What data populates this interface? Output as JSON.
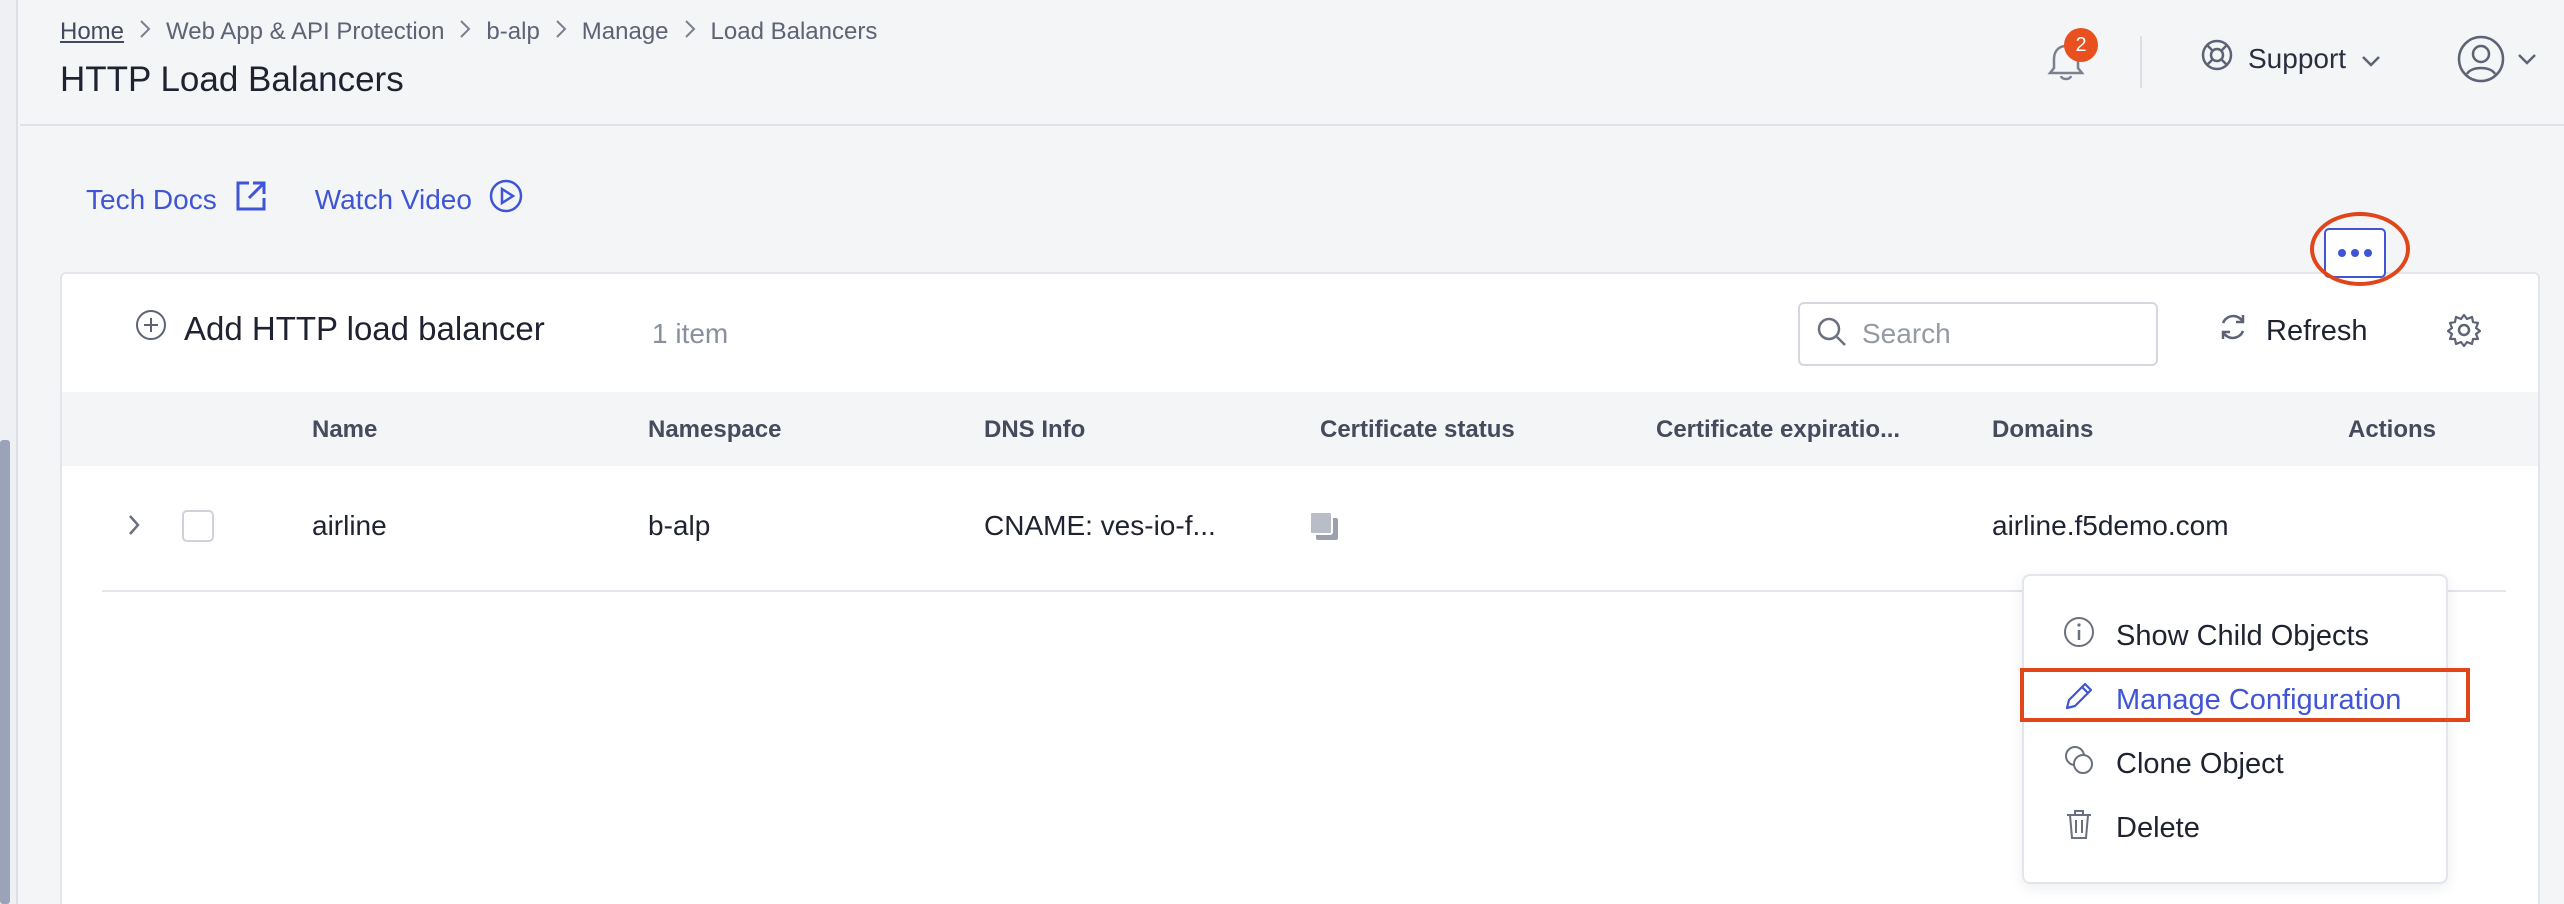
{
  "breadcrumb": {
    "items": [
      "Home",
      "Web App & API Protection",
      "b-alp",
      "Manage",
      "Load Balancers"
    ]
  },
  "page": {
    "title": "HTTP Load Balancers"
  },
  "header": {
    "notifications_count": "2",
    "support_label": "Support"
  },
  "links": {
    "tech_docs": "Tech Docs",
    "watch_video": "Watch Video"
  },
  "toolbar": {
    "add_label": "Add HTTP load balancer",
    "item_count": "1 item",
    "search_placeholder": "Search",
    "refresh_label": "Refresh"
  },
  "table": {
    "columns": [
      "Name",
      "Namespace",
      "DNS Info",
      "Certificate status",
      "Certificate expiratio...",
      "Domains",
      "Actions"
    ],
    "rows": [
      {
        "name": "airline",
        "namespace": "b-alp",
        "dns_info": "CNAME: ves-io-f...",
        "certificate_status": "",
        "certificate_expiration": "",
        "domains": "airline.f5demo.com"
      }
    ]
  },
  "actions_menu": {
    "items": [
      {
        "label": "Show Child Objects",
        "icon": "info-icon"
      },
      {
        "label": "Manage Configuration",
        "icon": "pencil-icon"
      },
      {
        "label": "Clone Object",
        "icon": "clone-icon"
      },
      {
        "label": "Delete",
        "icon": "trash-icon"
      }
    ]
  },
  "colors": {
    "accent": "#3f55d6",
    "highlight": "#e0461a",
    "badge": "#e8501f"
  }
}
